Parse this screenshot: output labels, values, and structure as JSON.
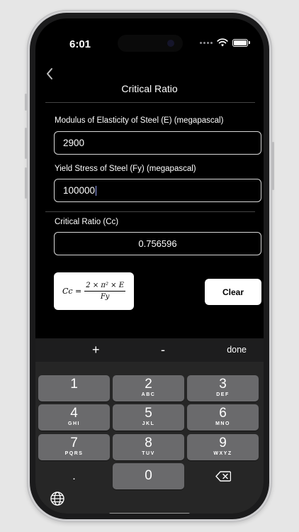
{
  "status_bar": {
    "time": "6:01"
  },
  "nav": {
    "title": "Critical Ratio"
  },
  "form": {
    "modulus": {
      "label": "Modulus of Elasticity of Steel (E) (megapascal)",
      "value": "2900"
    },
    "yield": {
      "label": "Yield Stress of Steel (Fy) (megapascal)",
      "value": "100000"
    },
    "result": {
      "label": "Critical Ratio (Cc)",
      "value": "0.756596"
    }
  },
  "formula": {
    "lhs": "Cc =",
    "numerator": "2 × π² × E",
    "denominator": "Fy"
  },
  "buttons": {
    "clear": "Clear"
  },
  "keyboard": {
    "accessory": {
      "plus": "+",
      "minus": "-",
      "done": "done"
    },
    "keys": [
      {
        "num": "1",
        "letters": ""
      },
      {
        "num": "2",
        "letters": "ABC"
      },
      {
        "num": "3",
        "letters": "DEF"
      },
      {
        "num": "4",
        "letters": "GHI"
      },
      {
        "num": "5",
        "letters": "JKL"
      },
      {
        "num": "6",
        "letters": "MNO"
      },
      {
        "num": "7",
        "letters": "PQRS"
      },
      {
        "num": "8",
        "letters": "TUV"
      },
      {
        "num": "9",
        "letters": "WXYZ"
      },
      {
        "num": "0",
        "letters": ""
      }
    ],
    "decimal": "."
  },
  "icons": {
    "back": "chevron-left-icon",
    "wifi": "wifi-icon",
    "battery": "battery-icon",
    "delete": "backspace-icon",
    "globe": "globe-icon"
  }
}
